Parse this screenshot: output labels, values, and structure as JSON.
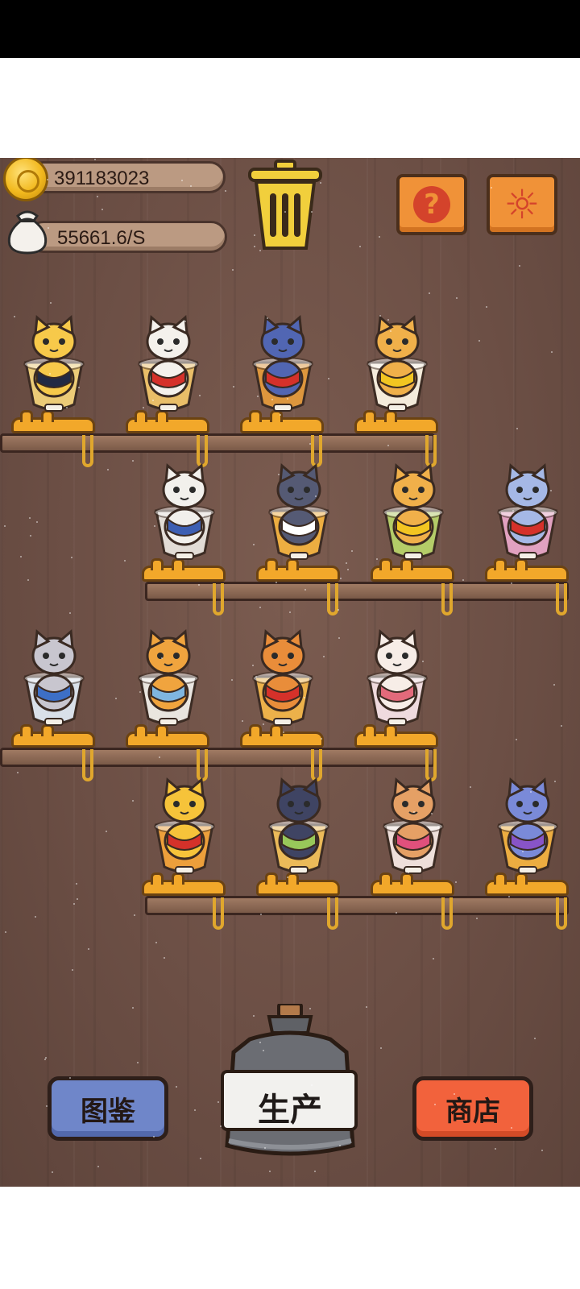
{
  "stats": {
    "coins": "391183023",
    "income_rate": "55661.6/S"
  },
  "icons": {
    "coin": "coin-icon",
    "money_bag": "money-bag-icon",
    "trash": "trash-can-icon",
    "help": "question-icon",
    "settings": "gear-icon"
  },
  "buttons": {
    "left_label": "图鉴",
    "center_label": "生产",
    "right_label": "商店"
  },
  "shelves": [
    {
      "cats": [
        {
          "name": "blonde-sunglasses-cat-in-parfait-glass",
          "cup": "#f3d27a",
          "body": "#f7c94a",
          "accent": "#222a44"
        },
        {
          "name": "white-cat-red-jacket-in-bowl",
          "cup": "#f0c46a",
          "body": "#f4f1ec",
          "accent": "#d5312a"
        },
        {
          "name": "blue-cat-red-hood-in-mug",
          "cup": "#e39a3d",
          "body": "#5166b3",
          "accent": "#d5312a"
        },
        {
          "name": "golden-armor-shiba-in-teacup",
          "cup": "#fbf4e3",
          "body": "#f0b04a",
          "accent": "#f2c521"
        }
      ]
    },
    {
      "cats": [
        {
          "name": "white-cat-blue-robe-in-bowl",
          "cup": "#e8e4de",
          "body": "#f2f0ec",
          "accent": "#3d5fb3"
        },
        {
          "name": "two-cats-in-beer-mug",
          "cup": "#f4b341",
          "body": "#555a74",
          "accent": "#ffffff"
        },
        {
          "name": "orange-cat-sunflower-in-green-glass",
          "cup": "#b8d36a",
          "body": "#f0b04a",
          "accent": "#f3c521"
        },
        {
          "name": "blue-cat-scarf-in-pink-glass",
          "cup": "#e8a6c7",
          "body": "#a5b8e6",
          "accent": "#d5312a"
        }
      ]
    },
    {
      "cats": [
        {
          "name": "grey-cat-checkered-hat-in-bowl",
          "cup": "#dfe8f2",
          "body": "#c8c6cf",
          "accent": "#3d6fc6"
        },
        {
          "name": "orange-cat-blue-cape-in-cup",
          "cup": "#f0ede8",
          "body": "#f0a43e",
          "accent": "#7fb6e0"
        },
        {
          "name": "orange-cat-red-hat-in-glass",
          "cup": "#f3b64a",
          "body": "#e98d3a",
          "accent": "#d5312a"
        },
        {
          "name": "white-cat-guitar-in-rose-glass",
          "cup": "#f6e2e6",
          "body": "#f7ede7",
          "accent": "#e26a7b"
        }
      ]
    },
    {
      "cats": [
        {
          "name": "yellow-cat-red-robe-in-cone",
          "cup": "#f3a43b",
          "body": "#f6c33a",
          "accent": "#d5312a"
        },
        {
          "name": "dark-cat-in-grape-glass",
          "cup": "#f2c05a",
          "body": "#3f4463",
          "accent": "#98c85a"
        },
        {
          "name": "llama-cat-in-pink-glass",
          "cup": "#f5e7e2",
          "body": "#e5a065",
          "accent": "#e0507c"
        },
        {
          "name": "blue-cat-witch-hat-in-beer-mug",
          "cup": "#f4b341",
          "body": "#7a8ad8",
          "accent": "#8854c7"
        }
      ]
    }
  ]
}
